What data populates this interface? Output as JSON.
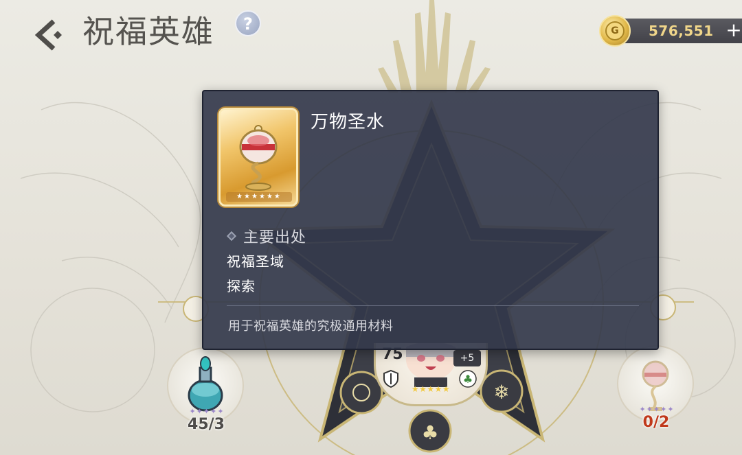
{
  "header": {
    "title": "祝福英雄",
    "help_label": "?"
  },
  "currency": {
    "icon_letter": "G",
    "amount": "576,551",
    "add_label": "+"
  },
  "popup": {
    "item_name": "万物圣水",
    "item_stars": "★★★★★★",
    "source_title": "主要出处",
    "sources": [
      "祝福圣域",
      "探索"
    ],
    "description": "用于祝福英雄的究极通用材料"
  },
  "hero": {
    "level": "75",
    "bonus": "+5",
    "stars": "★★★★★"
  },
  "slots": {
    "left": {
      "count": "45/3",
      "stars": "✦✦✦✦✦"
    },
    "right": {
      "count": "0/2",
      "stars": "✦✦✦✦✦"
    }
  },
  "colors": {
    "popup_bg": "#343a4c",
    "gold_text": "#f0d68a",
    "shortage_red": "#c0391b",
    "star_gold": "#f1c940"
  }
}
